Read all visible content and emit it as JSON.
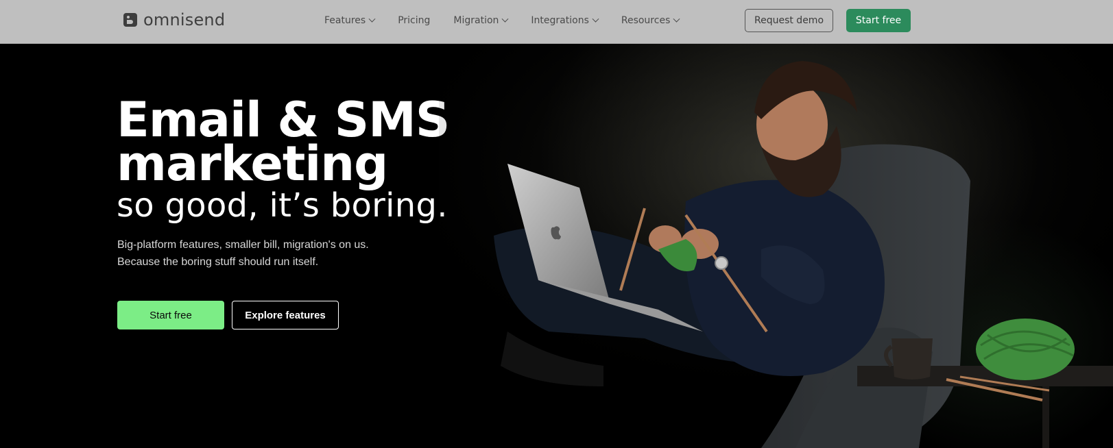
{
  "header": {
    "logo_text": "omnisend",
    "nav": [
      {
        "label": "Features",
        "has_dropdown": true
      },
      {
        "label": "Pricing",
        "has_dropdown": false
      },
      {
        "label": "Migration",
        "has_dropdown": true
      },
      {
        "label": "Integrations",
        "has_dropdown": true
      },
      {
        "label": "Resources",
        "has_dropdown": true
      }
    ],
    "request_demo_label": "Request demo",
    "start_free_label": "Start free"
  },
  "hero": {
    "headline_line1": "Email & SMS",
    "headline_line2": "marketing",
    "headline_line3": "so good, it’s boring.",
    "subtext_line1": "Big-platform features, smaller bill, migration's on us.",
    "subtext_line2": "Because the boring stuff should run itself.",
    "cta_primary": "Start free",
    "cta_secondary": "Explore features"
  },
  "colors": {
    "header_bg": "#bfbfbf",
    "brand_green": "#2c8b5c",
    "cta_green": "#7ced86",
    "hero_bg": "#000000"
  },
  "icons": [
    "omnisend-logo-icon",
    "chevron-down-icon",
    "apple-logo-icon"
  ]
}
